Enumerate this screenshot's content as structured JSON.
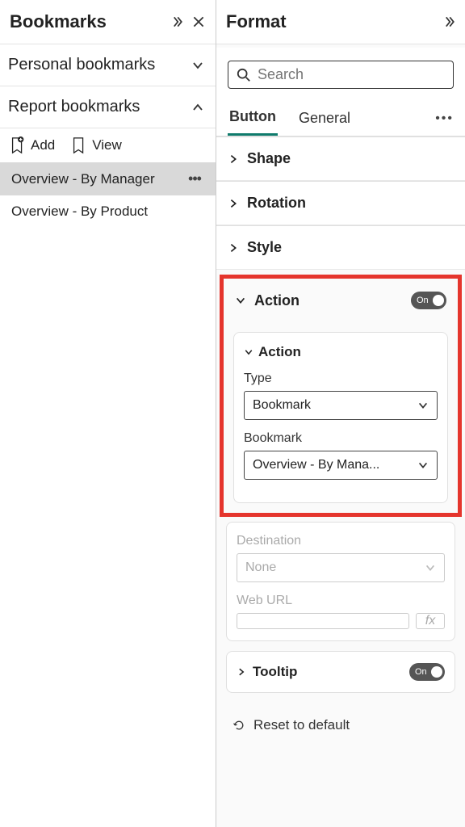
{
  "bookmarks": {
    "title": "Bookmarks",
    "sections": {
      "personal": {
        "label": "Personal bookmarks",
        "expanded": false
      },
      "report": {
        "label": "Report bookmarks",
        "expanded": true
      }
    },
    "toolbar": {
      "add": "Add",
      "view": "View"
    },
    "items": [
      {
        "label": "Overview - By Manager",
        "selected": true
      },
      {
        "label": "Overview - By Product",
        "selected": false
      }
    ]
  },
  "format": {
    "title": "Format",
    "search_placeholder": "Search",
    "tabs": {
      "button": "Button",
      "general": "General",
      "active": "button"
    },
    "groups": {
      "shape": {
        "label": "Shape",
        "expanded": false
      },
      "rotation": {
        "label": "Rotation",
        "expanded": false
      },
      "style": {
        "label": "Style",
        "expanded": false
      },
      "action": {
        "label": "Action",
        "expanded": true,
        "toggle": "On"
      },
      "tooltip": {
        "label": "Tooltip",
        "expanded": false,
        "toggle": "On"
      }
    },
    "action": {
      "sub_label": "Action",
      "type_label": "Type",
      "type_value": "Bookmark",
      "bookmark_label": "Bookmark",
      "bookmark_value": "Overview - By Mana...",
      "destination_label": "Destination",
      "destination_value": "None",
      "weburl_label": "Web URL",
      "weburl_value": "",
      "fx": "fx"
    },
    "reset_label": "Reset to default"
  }
}
